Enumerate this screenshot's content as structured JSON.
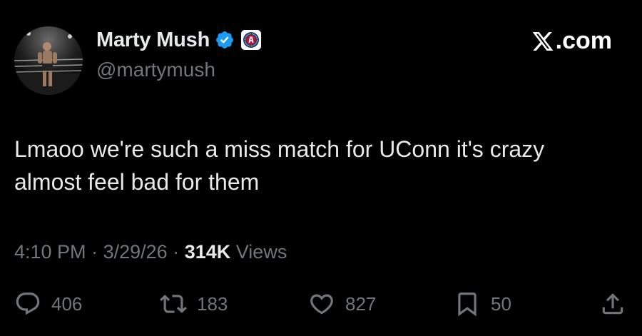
{
  "author": {
    "name": "Marty Mush",
    "handle": "@martymush",
    "verified_color": "#1d9bf0",
    "affiliate_badge_icon": "barstool-badge-icon"
  },
  "brand": {
    "label": ".com"
  },
  "tweet": {
    "text": "Lmaoo we're such a miss match for UConn it's crazy almost feel bad for them",
    "time": "4:10 PM",
    "sep1": "·",
    "date": "3/29/26",
    "sep2": "·",
    "views_count": "314K",
    "views_label": "Views"
  },
  "actions": {
    "replies": "406",
    "reposts": "183",
    "likes": "827",
    "bookmarks": "50"
  },
  "colors": {
    "background": "#000000",
    "text": "#e7e9ea",
    "muted": "#71767b",
    "verified": "#1d9bf0"
  }
}
